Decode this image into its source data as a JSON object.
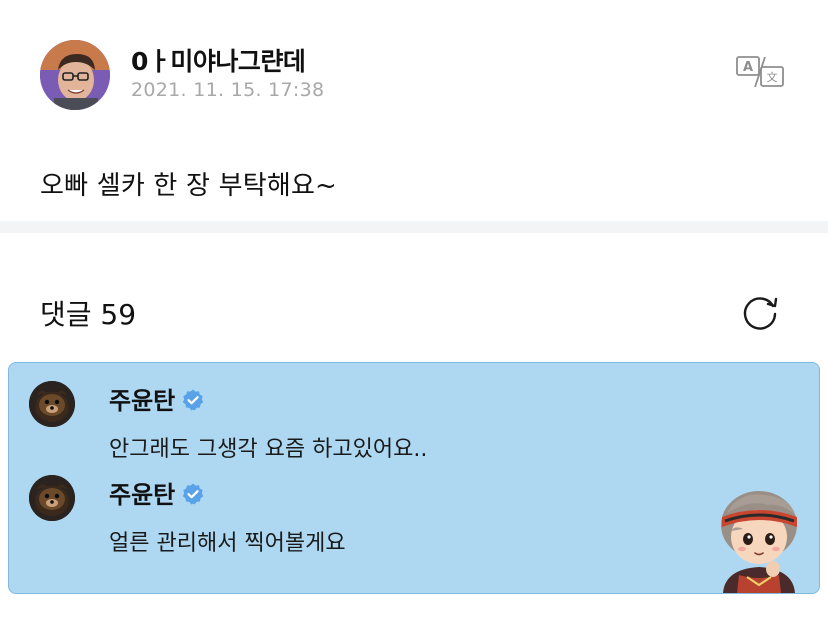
{
  "post": {
    "author": "0ㅏ미야나그랸데",
    "timestamp": "2021. 11. 15. 17:38",
    "body": "오빠 셀카 한 장 부탁해요~"
  },
  "comments_section": {
    "title": "댓글 59"
  },
  "comments": [
    {
      "author": "주윤탄",
      "text": "안그래도 그생각 요즘 하고있어요.."
    },
    {
      "author": "주윤탄",
      "text": "얼른 관리해서 찍어볼게요"
    }
  ],
  "icons": {
    "translate": "translate-icon",
    "refresh": "refresh-icon",
    "verified": "verified-badge-icon"
  },
  "colors": {
    "highlight_bg": "#aed8f2",
    "verified": "#5aa2e8",
    "muted_text": "#a8a8a8"
  }
}
